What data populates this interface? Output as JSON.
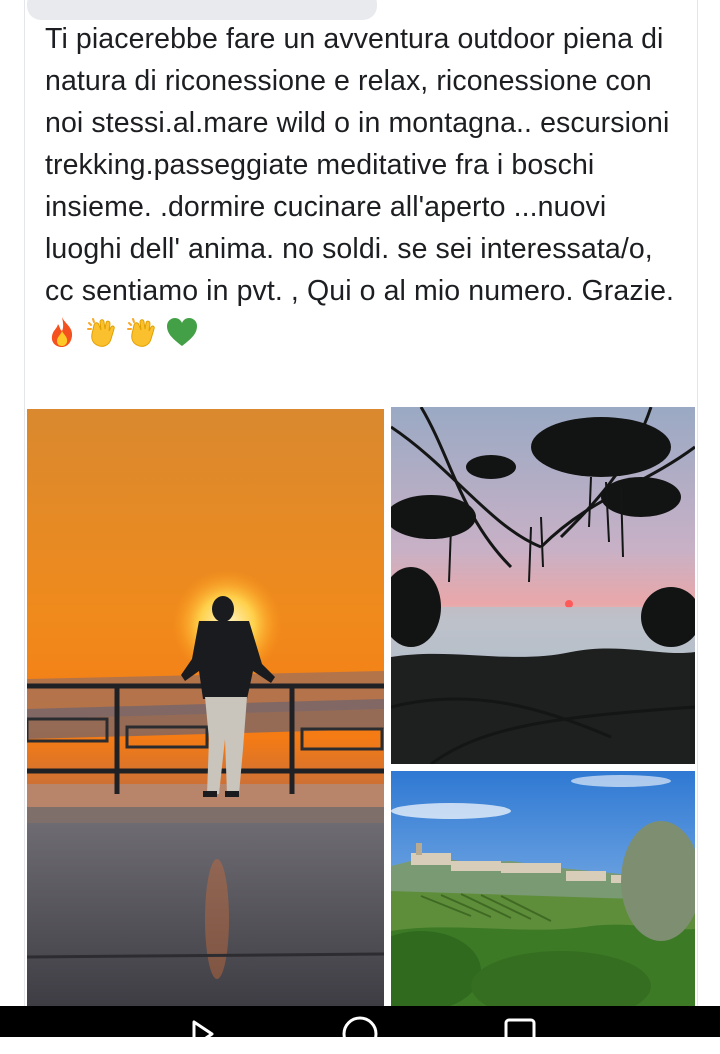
{
  "post": {
    "text": "Ti piacerebbe fare un avventura outdoor piena di natura di riconessione e relax, riconessione con noi stessi.al.mare wild o in montagna.. escursioni trekking.passeggiate meditative fra i boschi insieme. .dormire cucinare all'aperto ...nuovi luoghi dell' anima. no soldi. se sei interessata/o, cc sentiamo in pvt. , Qui o al mio numero. Grazie.",
    "emojis": [
      "fire-emoji",
      "clapping-hands-emoji",
      "clapping-hands-emoji",
      "green-heart-emoji"
    ]
  },
  "photos": [
    {
      "name": "photo-man-sunset-railing",
      "subject": "man at railing watching orange sunset"
    },
    {
      "name": "photo-sea-sunset-trees",
      "subject": "sea sunset through tree branches"
    },
    {
      "name": "photo-hill-town-vineyards",
      "subject": "hilltop town with vineyards"
    }
  ],
  "navigation": {
    "buttons": [
      "back-icon",
      "home-icon",
      "recents-icon"
    ]
  },
  "colors": {
    "text": "#1c1e21",
    "navbar": "#000000",
    "chip": "#e9eaed"
  }
}
